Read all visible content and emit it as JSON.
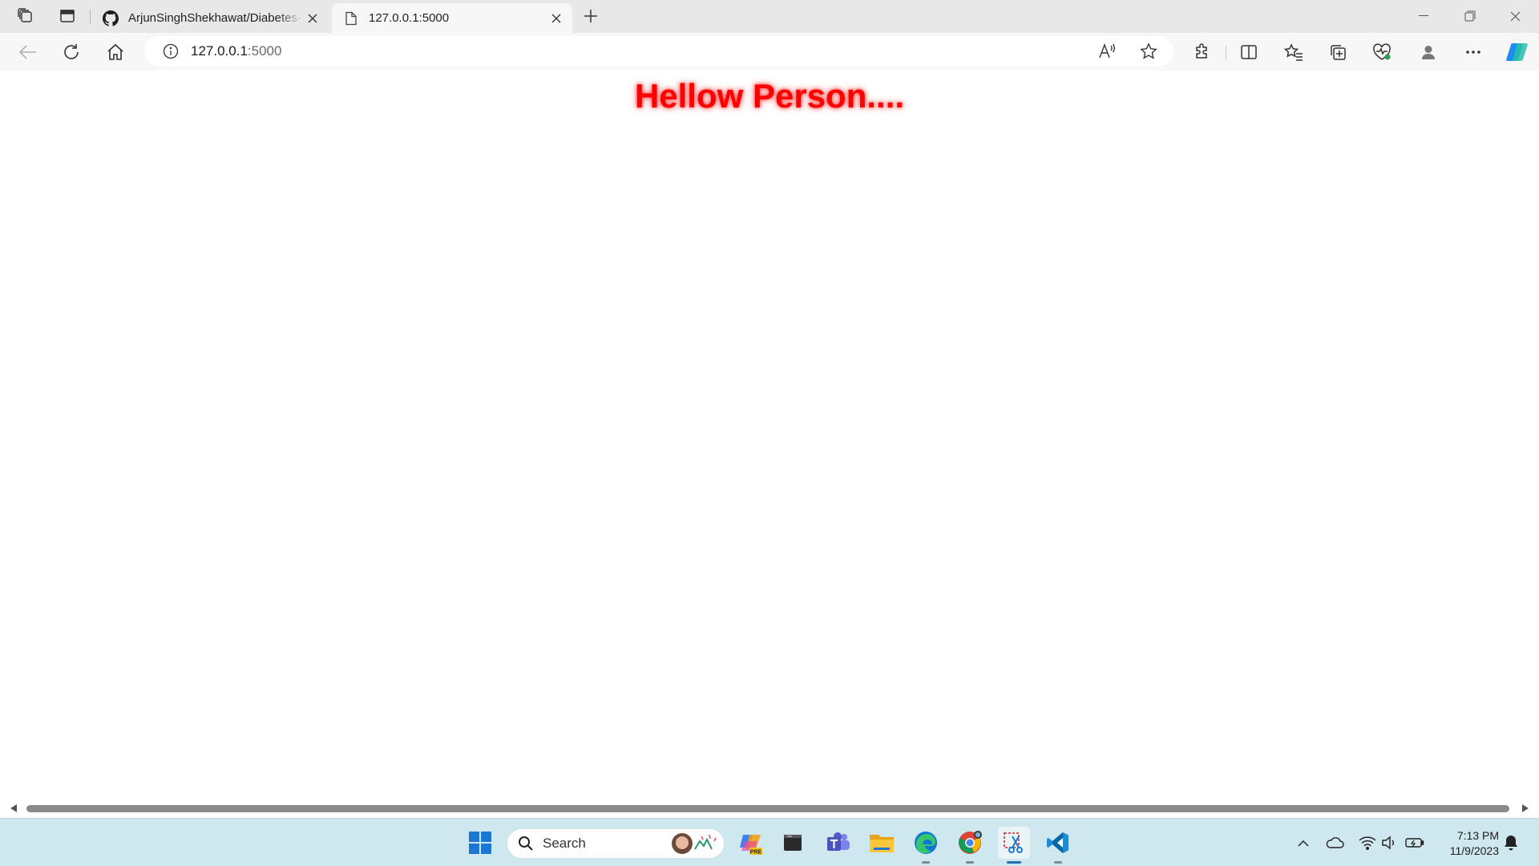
{
  "browser": {
    "tabs": [
      {
        "title": "ArjunSinghShekhawat/Diabetes-Prediction",
        "favicon": "github-icon",
        "active": false
      },
      {
        "title": "127.0.0.1:5000",
        "favicon": "page-icon",
        "active": true
      }
    ],
    "address": {
      "host": "127.0.0.1",
      "port": ":5000"
    },
    "colors": {
      "tabstrip": "#e8e8e8",
      "toolbar": "#f7f7f7",
      "copilot": "#1d8ef0"
    }
  },
  "page": {
    "greeting": "Hellow Person....",
    "greeting_color": "#ff0000"
  },
  "taskbar": {
    "search_label": "Search",
    "time": "7:13 PM",
    "date": "11/9/2023",
    "apps": [
      "windows-start-icon",
      "copilot-pre-icon",
      "terminal-app-icon",
      "teams-icon",
      "file-explorer-icon",
      "edge-icon",
      "chrome-icon",
      "snipping-tool-icon",
      "vscode-icon"
    ],
    "tray": [
      "chevron-up-icon",
      "onedrive-icon",
      "wifi-icon",
      "volume-icon",
      "battery-icon",
      "notification-bell-icon"
    ]
  }
}
